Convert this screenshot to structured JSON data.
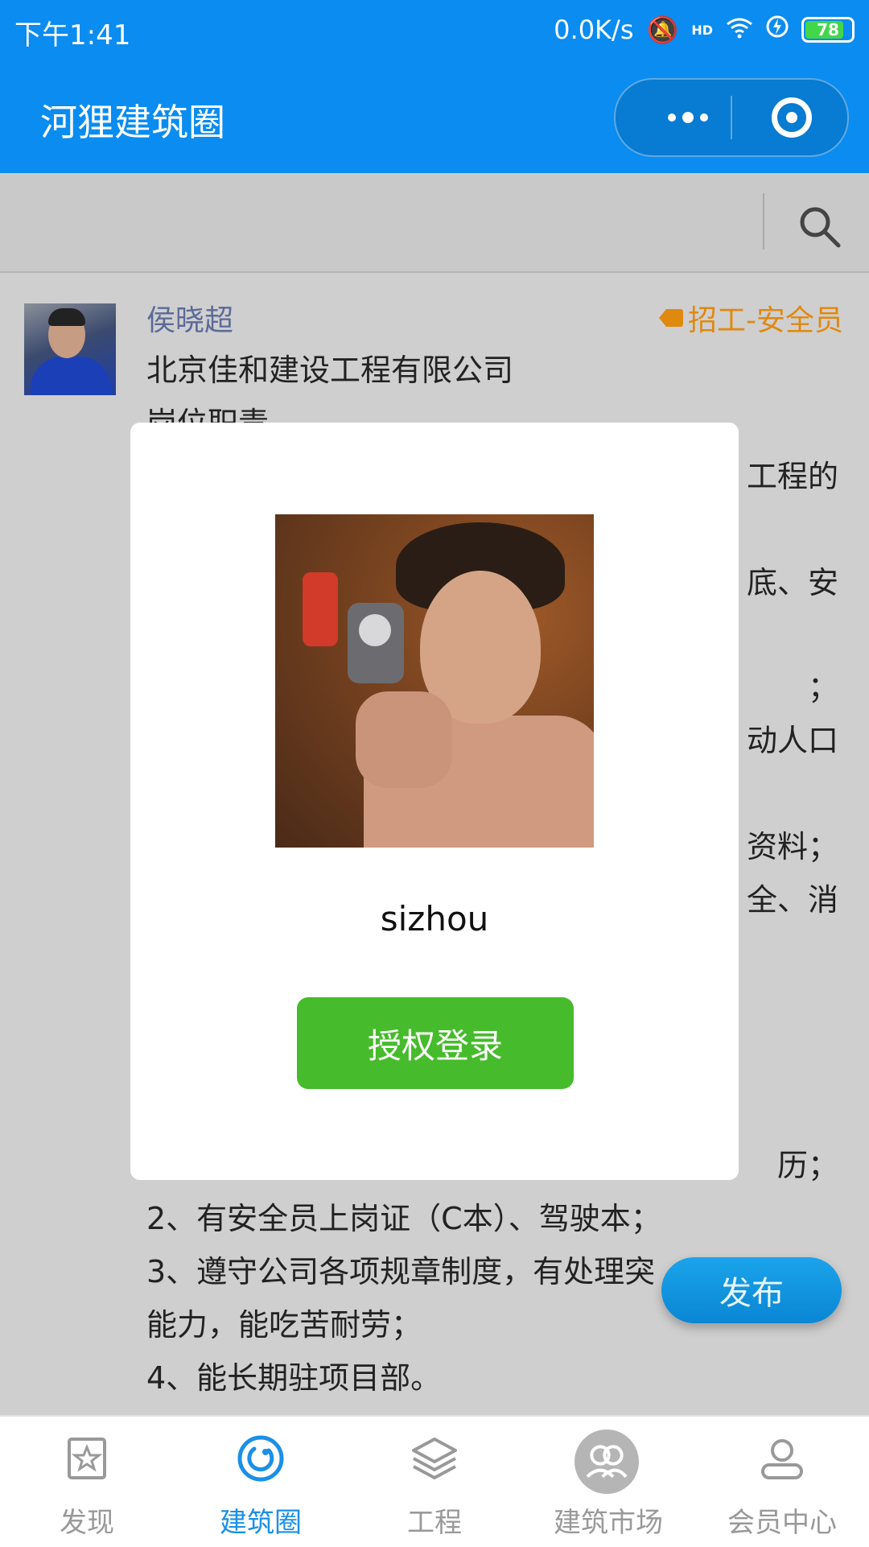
{
  "status_bar": {
    "time": "下午1:41",
    "network_speed": "0.0K/s",
    "signal_label": "HD",
    "battery": "78"
  },
  "header": {
    "title": "河狸建筑圈"
  },
  "post": {
    "author": "侯晓超",
    "tag": "招工-安全员",
    "company": "北京佳和建设工程有限公司",
    "section": "岗位职责",
    "peek_right": [
      "工程的",
      "底、安",
      "；",
      "动人口",
      "资料；",
      "全、消",
      "历；"
    ],
    "req_2": "2、有安全员上岗证（C本）、驾驶本；",
    "req_3_a": "3、遵守公司各项规章制度，有处理突",
    "req_3_b": "能力，能吃苦耐劳；",
    "req_4": "4、能长期驻项目部。"
  },
  "modal": {
    "username": "sizhou",
    "auth_button": "授权登录"
  },
  "publish_button": "发布",
  "tabs": [
    {
      "label": "发现",
      "icon": "star-frame-icon",
      "active": false
    },
    {
      "label": "建筑圈",
      "icon": "circle-swirl-icon",
      "active": true
    },
    {
      "label": "工程",
      "icon": "layers-icon",
      "active": false
    },
    {
      "label": "建筑市场",
      "icon": "market-people-icon",
      "active": false
    },
    {
      "label": "会员中心",
      "icon": "user-icon",
      "active": false
    }
  ],
  "colors": {
    "brand_blue": "#0a8cf0",
    "auth_green": "#46bb2b",
    "tag_orange": "#e0890f",
    "active_tab": "#1a90e6"
  }
}
